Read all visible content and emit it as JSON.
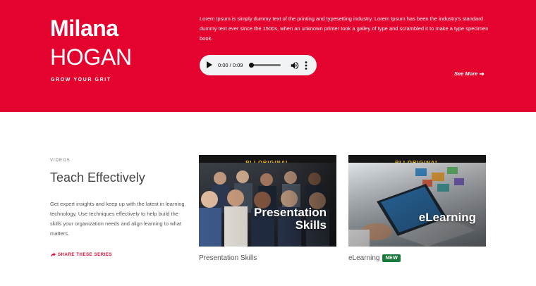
{
  "hero": {
    "first_name": "Milana",
    "last_name": "HOGAN",
    "tagline": "GROW YOUR GRIT",
    "bio": "Lorem Ipsum is simply dummy text of the printing and typesetting industry. Lorem Ipsum has been the industry's standard dummy text ever since the 1500s, when an unknown printer took a galley of type and scrambled it to make a type specimen book.",
    "audio": {
      "time": "0:00 / 0:09",
      "progress": 0
    },
    "see_more": "See More"
  },
  "section": {
    "label": "VIDEOS",
    "title": "Teach Effectively",
    "description": "Get expert insights and keep up with the latest in learning technology. Use techniques effectively to help build the skills your organization needs and align learning to what matters.",
    "share": "SHARE THESE SERIES"
  },
  "cards": [
    {
      "banner": "PLI ORIGINAL",
      "overlay_line1": "Presentation",
      "overlay_line2": "Skills",
      "caption": "Presentation Skills"
    },
    {
      "banner": "PLI ORIGINAL",
      "overlay_line1": "eLearning",
      "caption": "eLearning",
      "badge": "NEW"
    }
  ],
  "colors": {
    "brand_red": "#e4032e",
    "banner_yellow": "#f6c400",
    "badge_green": "#1a7a3c"
  }
}
